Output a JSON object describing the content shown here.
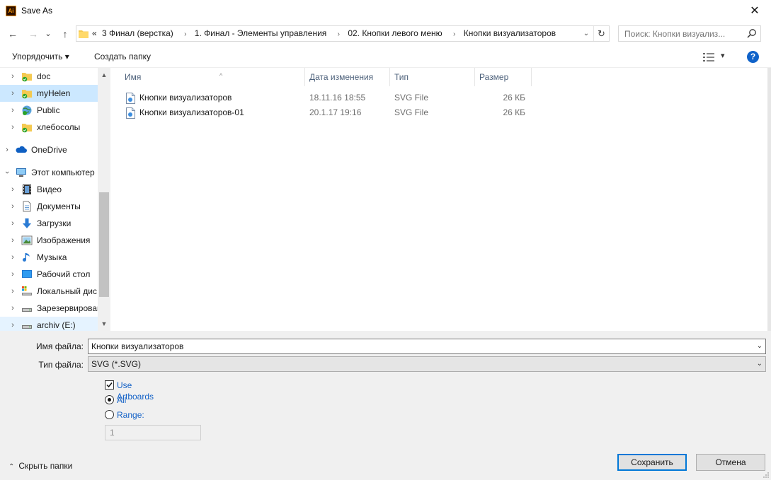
{
  "window": {
    "title": "Save As",
    "app_icon_text": "Ai",
    "close_glyph": "✕"
  },
  "address": {
    "back_glyph": "←",
    "forward_glyph": "→",
    "recent_glyph": "⌄",
    "up_glyph": "↑",
    "overflow": "«",
    "crumbs": [
      "3 Финал (верстка)",
      "1. Финал - Элементы управления",
      "02. Кнопки левого меню",
      "Кнопки визуализаторов"
    ],
    "separator_glyph": "›",
    "refresh_glyph": "↻",
    "dropdown_glyph": "⌄"
  },
  "search": {
    "placeholder": "Поиск: Кнопки визуализ..."
  },
  "toolbar": {
    "organize": "Упорядочить ▾",
    "new_folder": "Создать папку",
    "view_menu": "▾",
    "help": "?"
  },
  "nav": {
    "items": [
      {
        "label": "doc",
        "icon": "folder-sync-icon"
      },
      {
        "label": "myHelen",
        "icon": "folder-sync-icon"
      },
      {
        "label": "Public",
        "icon": "globe-sync-icon"
      },
      {
        "label": "хлебосолы",
        "icon": "folder-sync-icon"
      },
      {
        "label": "OneDrive",
        "icon": "cloud-icon"
      },
      {
        "label": "Этот компьютер",
        "icon": "computer-icon"
      },
      {
        "label": "Видео",
        "icon": "video-icon"
      },
      {
        "label": "Документы",
        "icon": "documents-icon"
      },
      {
        "label": "Загрузки",
        "icon": "downloads-icon"
      },
      {
        "label": "Изображения",
        "icon": "pictures-icon"
      },
      {
        "label": "Музыка",
        "icon": "music-icon"
      },
      {
        "label": "Рабочий стол",
        "icon": "desktop-icon"
      },
      {
        "label": "Локальный дис",
        "icon": "drive-icon"
      },
      {
        "label": "Зарезервирован",
        "icon": "drive-icon"
      },
      {
        "label": "archiv (E:)",
        "icon": "drive-icon"
      }
    ]
  },
  "files": {
    "columns": [
      "Имя",
      "Дата изменения",
      "Тип",
      "Размер"
    ],
    "rows": [
      {
        "name": "Кнопки визуализаторов",
        "date": "18.11.16 18:55",
        "type": "SVG File",
        "size": "26 КБ"
      },
      {
        "name": "Кнопки визуализаторов-01",
        "date": "20.1.17 19:16",
        "type": "SVG File",
        "size": "26 КБ"
      }
    ]
  },
  "form": {
    "filename_label": "Имя файла:",
    "filename_value": "Кнопки визуализаторов",
    "filetype_label": "Тип файла:",
    "filetype_value": "SVG (*.SVG)",
    "use_artboards": "Use Artboards",
    "all": "All",
    "range": "Range:",
    "range_value": "1"
  },
  "footer": {
    "hide_folders": "Скрыть папки",
    "hide_caret": "⌃",
    "save": "Сохранить",
    "cancel": "Отмена"
  },
  "colors": {
    "accent": "#0078d7",
    "link_blue": "#1462c7",
    "selection": "#cce8ff",
    "folder": "#f4c951",
    "sync_green": "#2aa32a"
  }
}
